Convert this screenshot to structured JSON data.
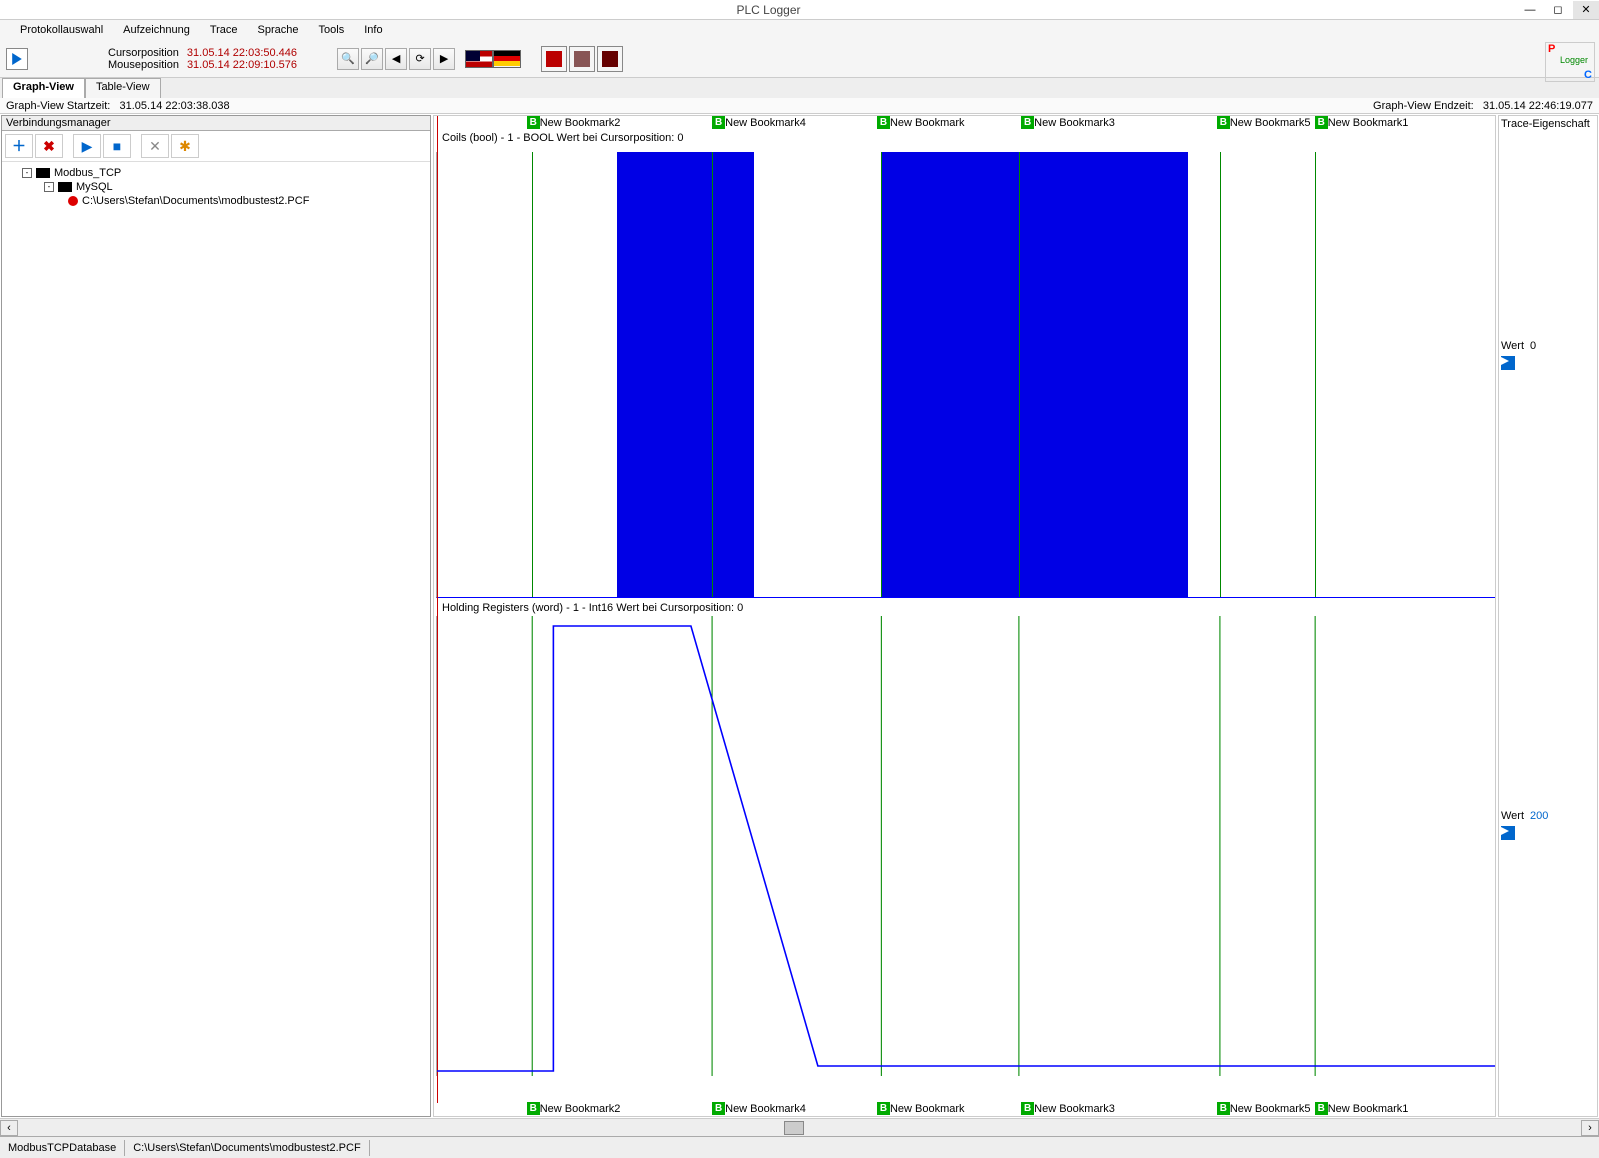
{
  "window": {
    "title": "PLC Logger"
  },
  "menu": [
    "Protokollauswahl",
    "Aufzeichnung",
    "Trace",
    "Sprache",
    "Tools",
    "Info"
  ],
  "positions": {
    "cursor_label": "Cursorposition",
    "cursor_val": "31.05.14 22:03:50.446",
    "mouse_label": "Mouseposition",
    "mouse_val": "31.05.14 22:09:10.576"
  },
  "tabs": {
    "graph": "Graph-View",
    "table": "Table-View"
  },
  "timeinfo": {
    "start_label": "Graph-View Startzeit:",
    "start_val": "31.05.14 22:03:38.038",
    "end_label": "Graph-View Endzeit:",
    "end_val": "31.05.14 22:46:19.077"
  },
  "sidebar": {
    "title": "Verbindungsmanager",
    "tree": {
      "root": "Modbus_TCP",
      "child": "MySQL",
      "leaf": "C:\\Users\\Stefan\\Documents\\modbustest2.PCF"
    }
  },
  "right_panel": {
    "title": "Trace-Eigenschaft"
  },
  "bookmarks": [
    {
      "x": 90,
      "label": "New Bookmark2"
    },
    {
      "x": 270,
      "label": "New Bookmark4"
    },
    {
      "x": 430,
      "label": "New Bookmark"
    },
    {
      "x": 570,
      "label": "New Bookmark3"
    },
    {
      "x": 760,
      "label": "New Bookmark5"
    },
    {
      "x": 855,
      "label": "New Bookmark1"
    }
  ],
  "channel1": {
    "label": "Coils (bool) - 1 - BOOL Wert bei Cursorposition: 0",
    "wert_label": "Wert",
    "wert_val": "0"
  },
  "channel2": {
    "label": "Holding Registers (word) - 1 - Int16 Wert bei Cursorposition: 0",
    "wert_label": "Wert",
    "wert_val": "200"
  },
  "statusbar": {
    "db": "ModbusTCPDatabase",
    "file": "C:\\Users\\Stefan\\Documents\\modbustest2.PCF"
  },
  "chart_data": [
    {
      "type": "area",
      "name": "Coils (bool) - 1",
      "ylim": [
        0,
        1
      ],
      "segments_high": [
        {
          "x_start_pct": 17,
          "x_end_pct": 30
        },
        {
          "x_start_pct": 42,
          "x_end_pct": 71
        }
      ],
      "value_at_cursor": 0
    },
    {
      "type": "line",
      "name": "Holding Registers (word) - 1",
      "points_pct": [
        {
          "x": 0,
          "y": 100
        },
        {
          "x": 11,
          "y": 100
        },
        {
          "x": 11,
          "y": 0
        },
        {
          "x": 24,
          "y": 0
        },
        {
          "x": 36,
          "y": 97
        },
        {
          "x": 100,
          "y": 97
        }
      ],
      "value_at_cursor": 0,
      "display_value": 200
    }
  ]
}
